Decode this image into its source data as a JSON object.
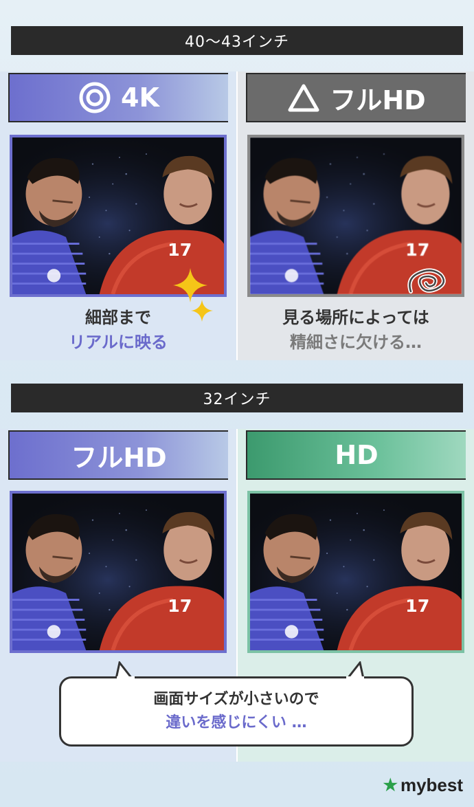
{
  "section1": {
    "title": "40〜43インチ",
    "left": {
      "badge_symbol": "double-circle-icon",
      "badge_label": "4K",
      "caption_line1": "細部まで",
      "caption_line2": "リアルに映る"
    },
    "right": {
      "badge_symbol": "triangle-icon",
      "badge_label": "フルHD",
      "caption_line1": "見る場所によっては",
      "caption_line2": "精細さに欠ける…"
    }
  },
  "section2": {
    "title": "32インチ",
    "left": {
      "badge_label": "フルHD"
    },
    "right": {
      "badge_label": "HD"
    },
    "bubble_line1": "画面サイズが小さいので",
    "bubble_line2": "違いを感じにくい …"
  },
  "brand": {
    "name": "mybest",
    "icon": "star-icon"
  },
  "colors": {
    "accent_blue": "#6d6fce",
    "accent_gray": "#6b6b6b",
    "accent_green": "#3c9a6e",
    "header_bar": "#2a2a2a",
    "sparkle": "#f5c518",
    "logo_star": "#2aa04a"
  },
  "icons": {
    "sparkle": "sparkle-icon",
    "blur_scribble": "blur-scribble-icon",
    "photo": "soccer-players-photo"
  }
}
